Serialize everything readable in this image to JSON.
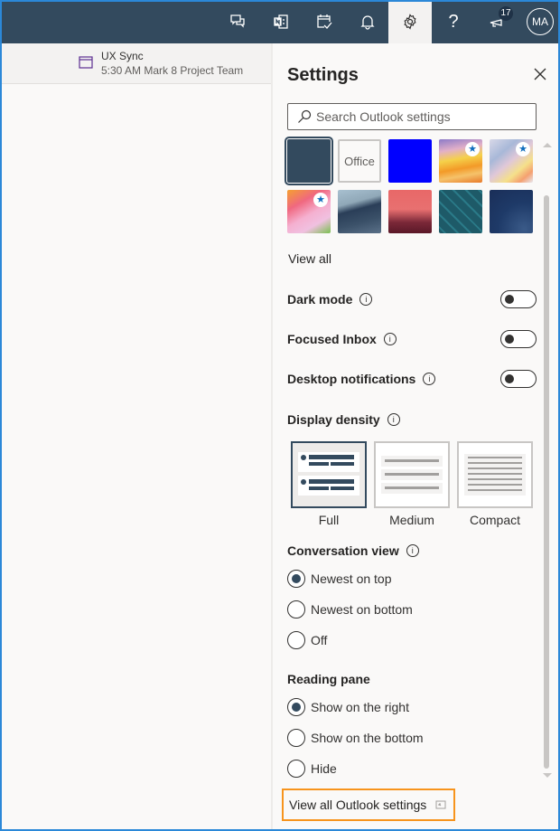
{
  "topbar": {
    "buttons": [
      {
        "name": "chat-button",
        "icon": "chat-icon"
      },
      {
        "name": "onenote-button",
        "icon": "onenote-icon"
      },
      {
        "name": "my-day-button",
        "icon": "calendar-check-icon"
      },
      {
        "name": "notifications-button",
        "icon": "bell-icon"
      },
      {
        "name": "settings-button",
        "icon": "gear-icon",
        "active": true
      },
      {
        "name": "help-button",
        "icon": "question-icon",
        "glyph": "?"
      },
      {
        "name": "feedback-button",
        "icon": "megaphone-icon",
        "badge": "17"
      }
    ],
    "avatar_initials": "MA"
  },
  "reminder": {
    "title": "UX Sync",
    "subtitle": "5:30 AM Mark 8 Project Team"
  },
  "settings": {
    "title": "Settings",
    "search_placeholder": "Search Outlook settings",
    "themes": [
      {
        "name": "navy",
        "color": "#334a5e",
        "selected": true
      },
      {
        "name": "office",
        "label": "Office"
      },
      {
        "name": "blue",
        "color": "#0000ff"
      },
      {
        "name": "rainbow",
        "premium": true
      },
      {
        "name": "swirl",
        "premium": true
      },
      {
        "name": "unicorn",
        "premium": true
      },
      {
        "name": "mountain"
      },
      {
        "name": "palms"
      },
      {
        "name": "circuit"
      },
      {
        "name": "blueprint"
      }
    ],
    "view_all_themes": "View all",
    "toggles": [
      {
        "label": "Dark mode",
        "on": false
      },
      {
        "label": "Focused Inbox",
        "on": false
      },
      {
        "label": "Desktop notifications",
        "on": false
      }
    ],
    "display_density": {
      "label": "Display density",
      "options": [
        "Full",
        "Medium",
        "Compact"
      ],
      "selected": "Full"
    },
    "conversation_view": {
      "label": "Conversation view",
      "options": [
        "Newest on top",
        "Newest on bottom",
        "Off"
      ],
      "selected": "Newest on top"
    },
    "reading_pane": {
      "label": "Reading pane",
      "options": [
        "Show on the right",
        "Show on the bottom",
        "Hide"
      ],
      "selected": "Show on the right"
    },
    "view_all_settings": "View all Outlook settings",
    "info_glyph": "i",
    "star_glyph": "★"
  }
}
